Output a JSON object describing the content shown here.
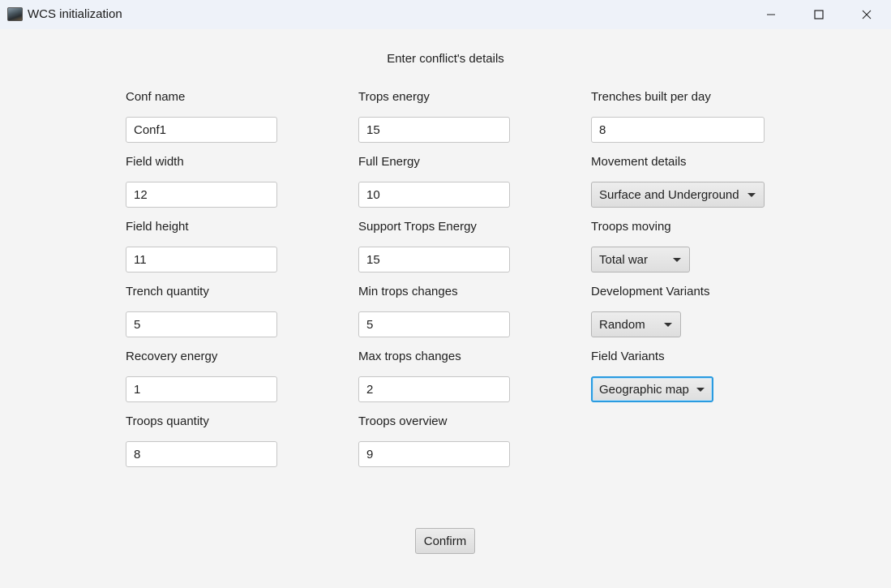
{
  "window": {
    "title": "WCS initialization"
  },
  "heading": "Enter conflict's details",
  "column1": [
    {
      "label": "Conf name",
      "value": "Conf1"
    },
    {
      "label": "Field width",
      "value": "12"
    },
    {
      "label": "Field height",
      "value": "11"
    },
    {
      "label": "Trench quantity",
      "value": "5"
    },
    {
      "label": "Recovery energy",
      "value": "1"
    },
    {
      "label": "Troops quantity",
      "value": "8"
    }
  ],
  "column2": [
    {
      "label": "Trops energy",
      "value": "15"
    },
    {
      "label": "Full Energy",
      "value": "10"
    },
    {
      "label": "Support Trops Energy",
      "value": "15"
    },
    {
      "label": "Min trops changes",
      "value": "5"
    },
    {
      "label": "Max trops changes",
      "value": "2"
    },
    {
      "label": "Troops overview",
      "value": "9"
    }
  ],
  "column3": {
    "trenches": {
      "label": "Trenches built per day",
      "value": "8"
    },
    "movement": {
      "label": "Movement details",
      "selected": "Surface and Underground"
    },
    "troops_moving": {
      "label": "Troops moving",
      "selected": "Total war"
    },
    "development": {
      "label": "Development Variants",
      "selected": "Random"
    },
    "field_variants": {
      "label": "Field Variants",
      "selected": "Geographic map"
    }
  },
  "confirm_label": "Confirm",
  "colors": {
    "focus": "#2a9be0",
    "background": "#f4f4f4",
    "titlebar": "#eef2f9"
  }
}
